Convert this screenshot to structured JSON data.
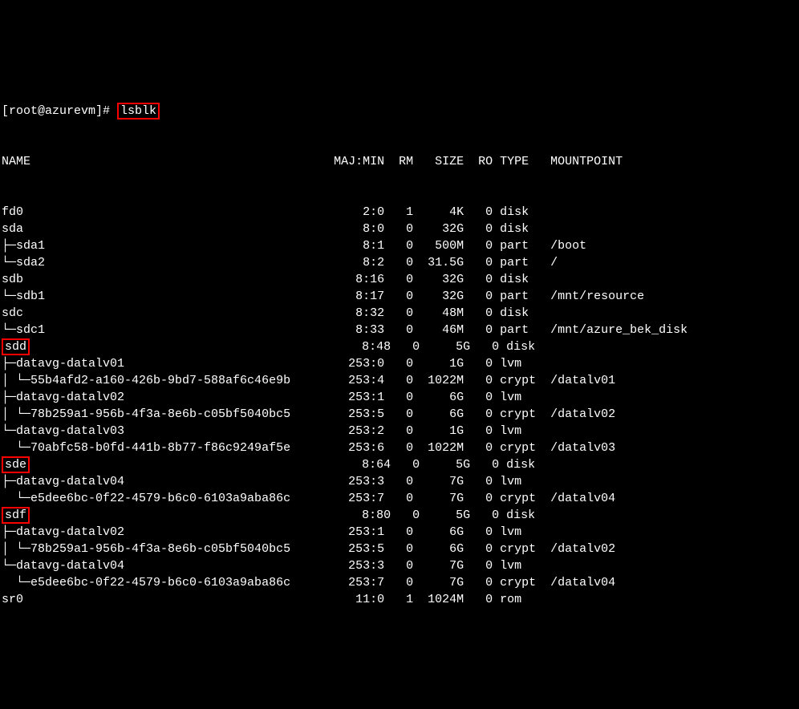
{
  "prompt": "[root@azurevm]# ",
  "command": "lsblk",
  "columns": {
    "name": "NAME",
    "majmin": "MAJ:MIN",
    "rm": "RM",
    "size": "SIZE",
    "ro": "RO",
    "type": "TYPE",
    "mount": "MOUNTPOINT"
  },
  "rows": [
    {
      "prefix": "",
      "name": "fd0",
      "hl": false,
      "majmin": "2:0",
      "rm": "1",
      "size": "4K",
      "ro": "0",
      "type": "disk",
      "mount": ""
    },
    {
      "prefix": "",
      "name": "sda",
      "hl": false,
      "majmin": "8:0",
      "rm": "0",
      "size": "32G",
      "ro": "0",
      "type": "disk",
      "mount": ""
    },
    {
      "prefix": "├─",
      "name": "sda1",
      "hl": false,
      "majmin": "8:1",
      "rm": "0",
      "size": "500M",
      "ro": "0",
      "type": "part",
      "mount": "/boot"
    },
    {
      "prefix": "└─",
      "name": "sda2",
      "hl": false,
      "majmin": "8:2",
      "rm": "0",
      "size": "31.5G",
      "ro": "0",
      "type": "part",
      "mount": "/"
    },
    {
      "prefix": "",
      "name": "sdb",
      "hl": false,
      "majmin": "8:16",
      "rm": "0",
      "size": "32G",
      "ro": "0",
      "type": "disk",
      "mount": ""
    },
    {
      "prefix": "└─",
      "name": "sdb1",
      "hl": false,
      "majmin": "8:17",
      "rm": "0",
      "size": "32G",
      "ro": "0",
      "type": "part",
      "mount": "/mnt/resource"
    },
    {
      "prefix": "",
      "name": "sdc",
      "hl": false,
      "majmin": "8:32",
      "rm": "0",
      "size": "48M",
      "ro": "0",
      "type": "disk",
      "mount": ""
    },
    {
      "prefix": "└─",
      "name": "sdc1",
      "hl": false,
      "majmin": "8:33",
      "rm": "0",
      "size": "46M",
      "ro": "0",
      "type": "part",
      "mount": "/mnt/azure_bek_disk"
    },
    {
      "prefix": "",
      "name": "sdd",
      "hl": true,
      "majmin": "8:48",
      "rm": "0",
      "size": "5G",
      "ro": "0",
      "type": "disk",
      "mount": ""
    },
    {
      "prefix": "├─",
      "name": "datavg-datalv01",
      "hl": false,
      "majmin": "253:0",
      "rm": "0",
      "size": "1G",
      "ro": "0",
      "type": "lvm",
      "mount": ""
    },
    {
      "prefix": "│ └─",
      "name": "55b4afd2-a160-426b-9bd7-588af6c46e9b",
      "hl": false,
      "majmin": "253:4",
      "rm": "0",
      "size": "1022M",
      "ro": "0",
      "type": "crypt",
      "mount": "/datalv01"
    },
    {
      "prefix": "├─",
      "name": "datavg-datalv02",
      "hl": false,
      "majmin": "253:1",
      "rm": "0",
      "size": "6G",
      "ro": "0",
      "type": "lvm",
      "mount": ""
    },
    {
      "prefix": "│ └─",
      "name": "78b259a1-956b-4f3a-8e6b-c05bf5040bc5",
      "hl": false,
      "majmin": "253:5",
      "rm": "0",
      "size": "6G",
      "ro": "0",
      "type": "crypt",
      "mount": "/datalv02"
    },
    {
      "prefix": "└─",
      "name": "datavg-datalv03",
      "hl": false,
      "majmin": "253:2",
      "rm": "0",
      "size": "1G",
      "ro": "0",
      "type": "lvm",
      "mount": ""
    },
    {
      "prefix": "  └─",
      "name": "70abfc58-b0fd-441b-8b77-f86c9249af5e",
      "hl": false,
      "majmin": "253:6",
      "rm": "0",
      "size": "1022M",
      "ro": "0",
      "type": "crypt",
      "mount": "/datalv03"
    },
    {
      "prefix": "",
      "name": "sde",
      "hl": true,
      "majmin": "8:64",
      "rm": "0",
      "size": "5G",
      "ro": "0",
      "type": "disk",
      "mount": ""
    },
    {
      "prefix": "├─",
      "name": "datavg-datalv04",
      "hl": false,
      "majmin": "253:3",
      "rm": "0",
      "size": "7G",
      "ro": "0",
      "type": "lvm",
      "mount": ""
    },
    {
      "prefix": "  └─",
      "name": "e5dee6bc-0f22-4579-b6c0-6103a9aba86c",
      "hl": false,
      "majmin": "253:7",
      "rm": "0",
      "size": "7G",
      "ro": "0",
      "type": "crypt",
      "mount": "/datalv04"
    },
    {
      "prefix": "",
      "name": "sdf",
      "hl": true,
      "majmin": "8:80",
      "rm": "0",
      "size": "5G",
      "ro": "0",
      "type": "disk",
      "mount": ""
    },
    {
      "prefix": "├─",
      "name": "datavg-datalv02",
      "hl": false,
      "majmin": "253:1",
      "rm": "0",
      "size": "6G",
      "ro": "0",
      "type": "lvm",
      "mount": ""
    },
    {
      "prefix": "│ └─",
      "name": "78b259a1-956b-4f3a-8e6b-c05bf5040bc5",
      "hl": false,
      "majmin": "253:5",
      "rm": "0",
      "size": "6G",
      "ro": "0",
      "type": "crypt",
      "mount": "/datalv02"
    },
    {
      "prefix": "└─",
      "name": "datavg-datalv04",
      "hl": false,
      "majmin": "253:3",
      "rm": "0",
      "size": "7G",
      "ro": "0",
      "type": "lvm",
      "mount": ""
    },
    {
      "prefix": "  └─",
      "name": "e5dee6bc-0f22-4579-b6c0-6103a9aba86c",
      "hl": false,
      "majmin": "253:7",
      "rm": "0",
      "size": "7G",
      "ro": "0",
      "type": "crypt",
      "mount": "/datalv04"
    },
    {
      "prefix": "",
      "name": "sr0",
      "hl": false,
      "majmin": "11:0",
      "rm": "1",
      "size": "1024M",
      "ro": "0",
      "type": "rom",
      "mount": ""
    }
  ],
  "widths": {
    "name_col": 46,
    "majmin": 7,
    "rm": 3,
    "size": 6,
    "ro": 3,
    "type": 5
  }
}
